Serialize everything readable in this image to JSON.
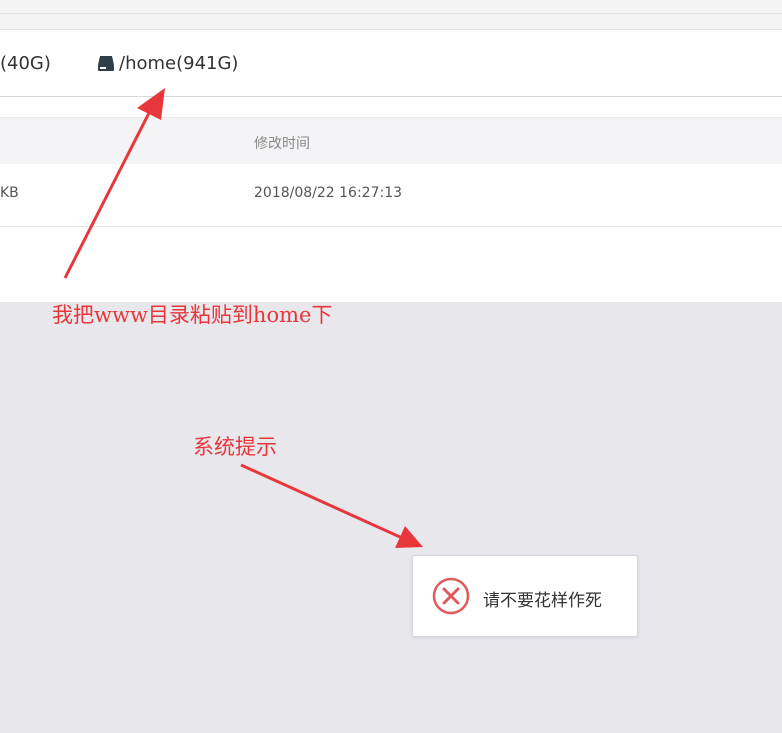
{
  "disks": [
    {
      "label": "(40G)",
      "icon": "drive-icon"
    },
    {
      "label": "/home(941G)",
      "icon": "drive-icon"
    }
  ],
  "table": {
    "columns": {
      "mtime": "修改时间"
    },
    "rows": [
      {
        "size": "KB",
        "mtime": "2018/08/22 16:27:13"
      }
    ]
  },
  "annotations": {
    "paste_note": "我把www目录粘贴到home下",
    "system_hint": "系统提示"
  },
  "toast": {
    "message": "请不要花样作死",
    "icon": "error-circle-icon"
  },
  "colors": {
    "annotation_red": "#e8373b",
    "toast_icon_red": "#e05a5a",
    "backdrop": "#e7e7ec"
  }
}
